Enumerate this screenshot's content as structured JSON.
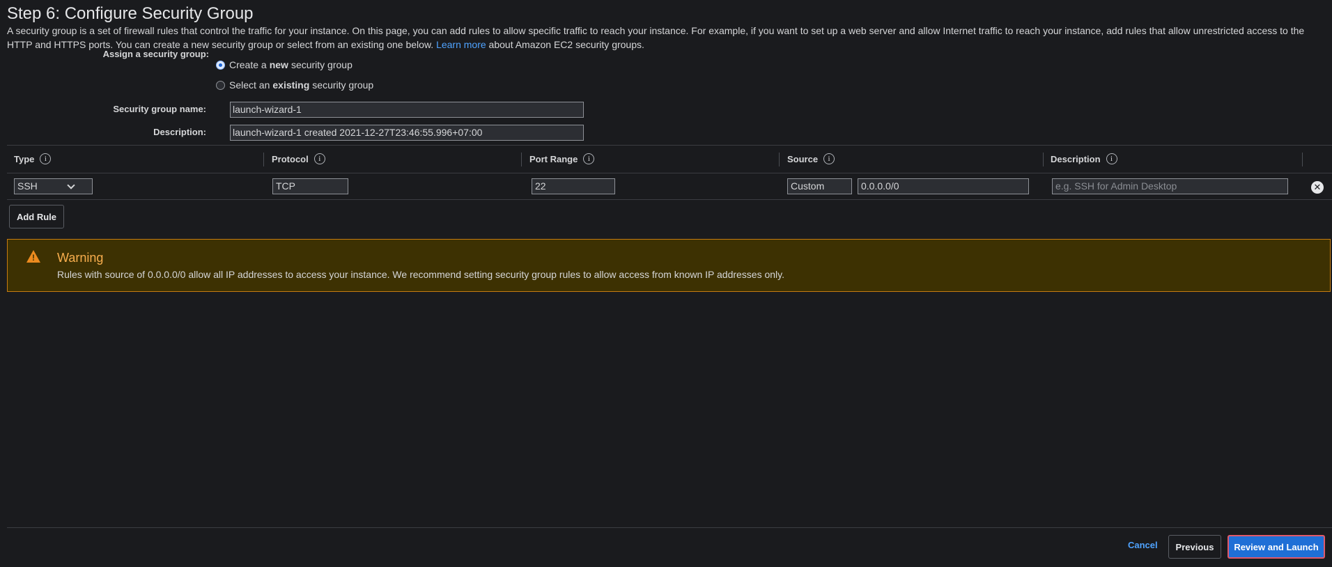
{
  "page": {
    "title": "Step 6: Configure Security Group",
    "intro_text": "A security group is a set of firewall rules that control the traffic for your instance. On this page, you can add rules to allow specific traffic to reach your instance. For example, if you want to set up a web server and allow Internet traffic to reach your instance, add rules that allow unrestricted access to the HTTP and HTTPS ports. You can create a new security group or select from an existing one below.",
    "learn_more": "Learn more",
    "intro_suffix": "about Amazon EC2 security groups."
  },
  "assign": {
    "label": "Assign a security group:",
    "option_new_pre": "Create a",
    "option_new_bold": "new",
    "option_new_post": "security group",
    "option_existing_pre": "Select an",
    "option_existing_bold": "existing",
    "option_existing_post": "security group",
    "selected": "new"
  },
  "form": {
    "name_label": "Security group name:",
    "name_value": "launch-wizard-1",
    "desc_label": "Description:",
    "desc_value": "launch-wizard-1 created 2021-12-27T23:46:55.996+07:00"
  },
  "table": {
    "headers": [
      "Type",
      "Protocol",
      "Port Range",
      "Source",
      "Description"
    ],
    "info_glyph": "i",
    "rows": [
      {
        "type": "SSH",
        "protocol": "TCP",
        "port_range": "22",
        "source_type": "Custom",
        "source_cidr": "0.0.0.0/0",
        "description_placeholder": "e.g. SSH for Admin Desktop"
      }
    ],
    "remove_glyph": "✕",
    "add_rule": "Add Rule"
  },
  "warning": {
    "title": "Warning",
    "text": "Rules with source of 0.0.0.0/0 allow all IP addresses to access your instance. We recommend setting security group rules to allow access from known IP addresses only.",
    "glyph": "!"
  },
  "footer": {
    "cancel": "Cancel",
    "previous": "Previous",
    "review": "Review and Launch"
  },
  "colors": {
    "background": "#1a1b1e",
    "link": "#4fa3ff",
    "warning_bg": "#3d3102",
    "warning_border": "#c77d10",
    "primary": "#1f6fd6"
  }
}
